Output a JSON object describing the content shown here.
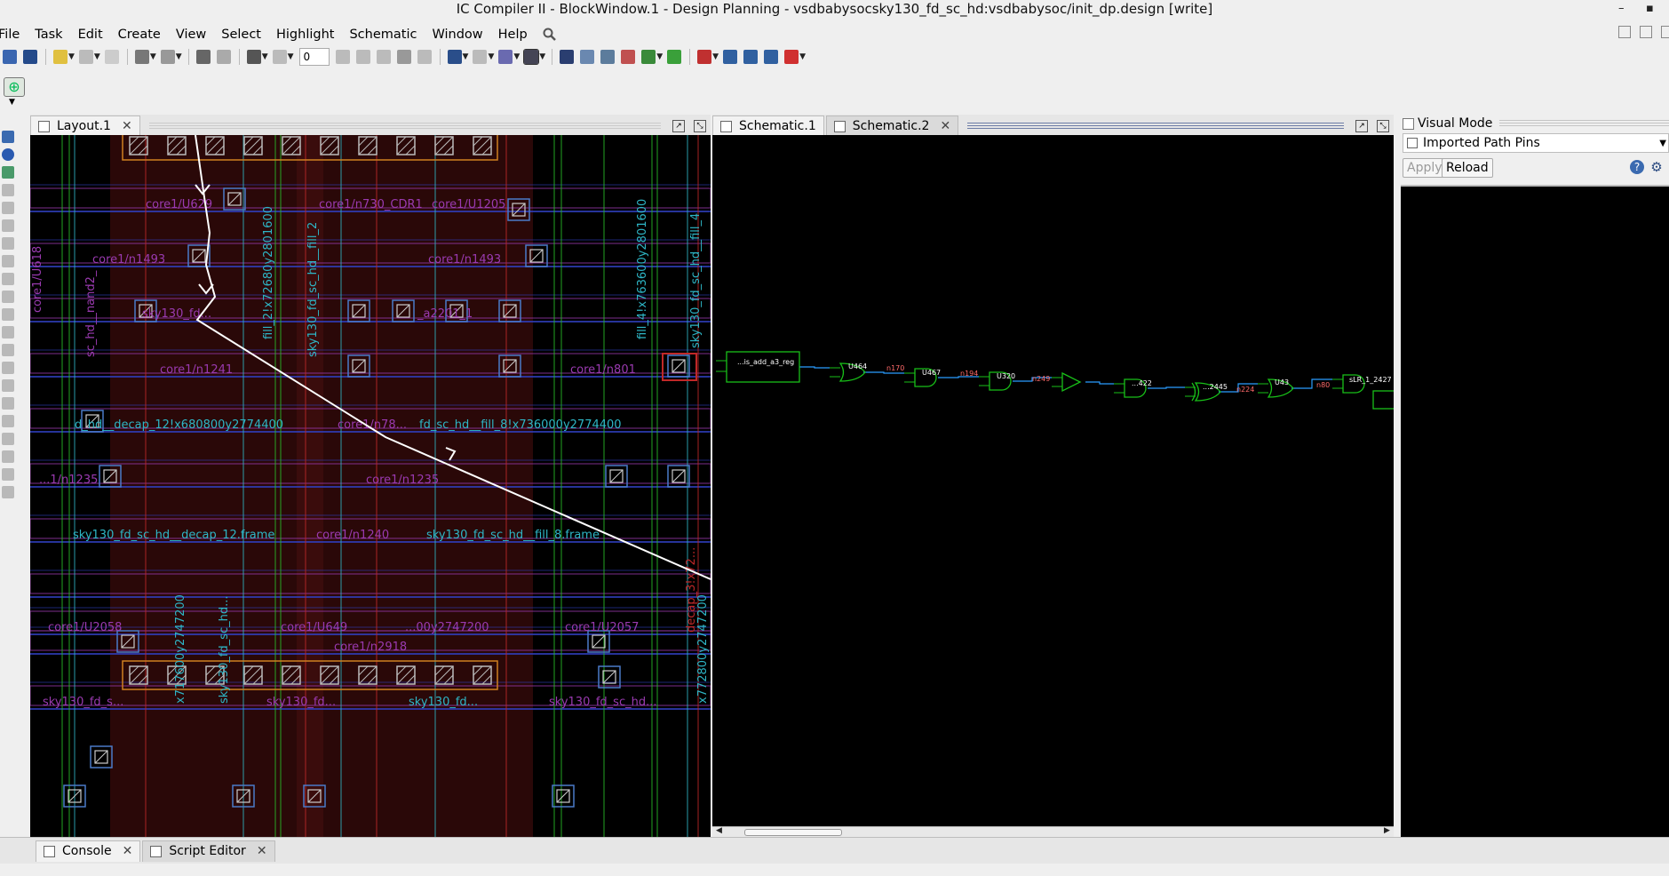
{
  "window": {
    "title": "IC Compiler II - BlockWindow.1 - Design Planning - vsdbabysocsky130_fd_sc_hd:vsdbabysoc/init_dp.design [write]",
    "minimize": "–",
    "maximize": "▪"
  },
  "menu": [
    "File",
    "Task",
    "Edit",
    "Create",
    "View",
    "Select",
    "Highlight",
    "Schematic",
    "Window",
    "Help"
  ],
  "toolbar": {
    "spin_value": "0"
  },
  "layout_tab": {
    "label": "Layout.1",
    "close": "✕"
  },
  "schematic_tabs": [
    {
      "label": "Schematic.1",
      "close": ""
    },
    {
      "label": "Schematic.2",
      "close": "✕"
    }
  ],
  "right_panel": {
    "header": "Visual Mode",
    "combo_value": "Imported Path Pins",
    "apply_label": "Apply",
    "reload_label": "Reload",
    "help_icon": "?",
    "gear_icon": "⚙"
  },
  "bottom_tabs": [
    {
      "label": "Console",
      "close": "✕"
    },
    {
      "label": "Script Editor",
      "close": "✕"
    }
  ],
  "layout_labels": [
    "core1/U629",
    "core1/n730_CDR1",
    "core1/U1205",
    "core1/n1493",
    "core1/n1493",
    "sky130_fd...",
    "core1/n1241",
    "core1/n801",
    "d_hd__decap_12!x680800y2774400",
    "core1/n78...",
    "fd_sc_hd__fill_8!x736000y2774400",
    "...1/n1235",
    "core1/n1235",
    "sky130_fd_sc_hd__decap_12.frame",
    "core1/n1240",
    "sky130_fd_sc_hd__fill_8.frame",
    "core1/U2058",
    "core1/U649",
    "...00y2747200",
    "core1/U2057",
    "core1/n2918",
    "sky130_fd_s...",
    "sky130_fd...",
    "sky130_fd...",
    "sky130_fd_sc_hd...",
    "core1/U618",
    "_a2201_1",
    "fill_2!x72680y2801600",
    "sky130_fd_sc_hd__fill_2",
    "fill_4!x763600y2801600",
    "sky130_fd_sc_hd__fill_4",
    "x717600y2747200",
    "sky130_fd_sc_hd...",
    "x772800y2747200",
    "decap_3!x72...",
    "sc_hd__nand2_"
  ],
  "schematic_cells": [
    "...is_add_a3_reg",
    "U464",
    "U467",
    "U320",
    "...422",
    "...2445",
    "U43",
    "sLR_1_2427"
  ],
  "schematic_nets": [
    "n170",
    "n194",
    "n249",
    "n224",
    "n80"
  ],
  "colors": {
    "canvas_bg": "#000000",
    "schematic_cell": "#18c018",
    "schematic_net": "#2a9cff",
    "net_label": "#ff6a6a",
    "layout_magenta": "#9a3ab0",
    "layout_cyan": "#2eb6c6",
    "layout_green": "#28c028",
    "layout_red": "#c02828",
    "flight_line": "#ffffff"
  }
}
